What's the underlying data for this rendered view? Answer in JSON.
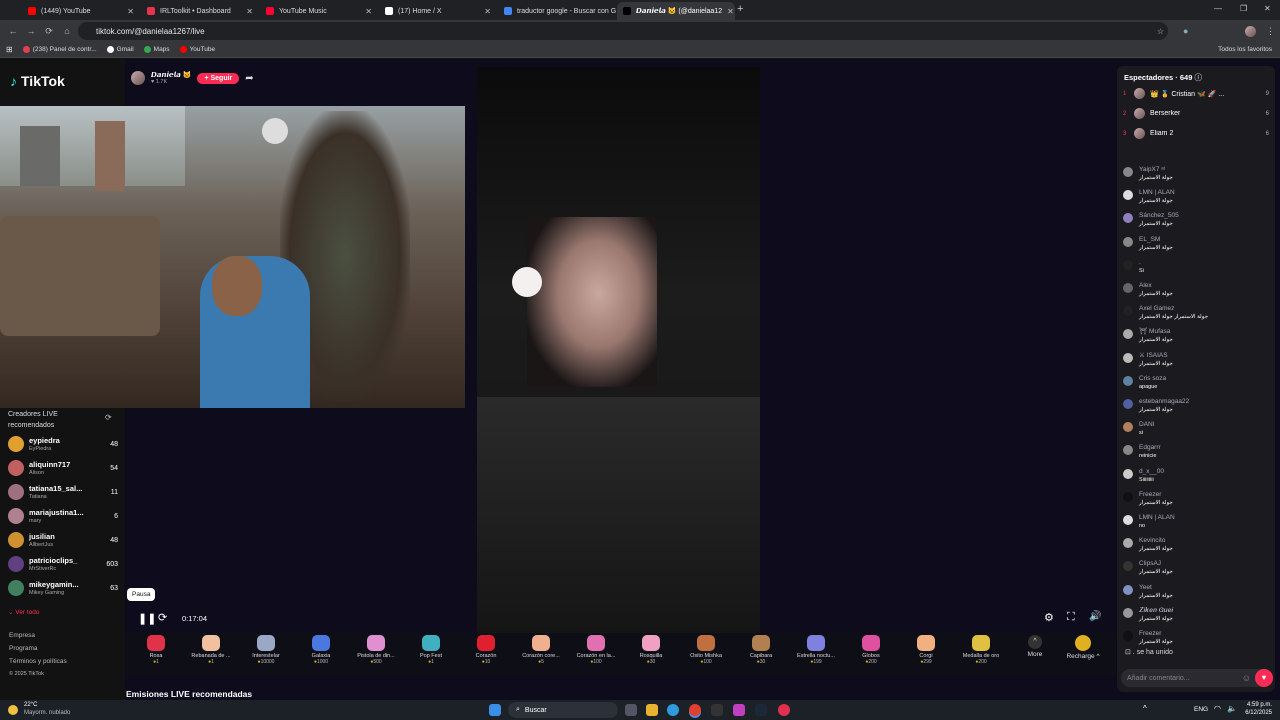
{
  "browser": {
    "tabs": [
      {
        "title": "(1449) YouTube",
        "color": "#ff0000",
        "active": false
      },
      {
        "title": "IRLToolkit • Dashboard",
        "color": "#e8334a",
        "active": false
      },
      {
        "title": "YouTube Music",
        "color": "#ff0033",
        "active": false
      },
      {
        "title": "(17) Home / X",
        "color": "#ffffff",
        "active": false
      },
      {
        "title": "traductor google - Buscar con G",
        "color": "#4285f4",
        "active": false
      },
      {
        "title": "𝘿𝙖𝙣𝙞𝙚𝙡𝙖 🐱 (@danielaa12",
        "color": "#000000",
        "active": true
      }
    ],
    "url": "tiktok.com/@danielaa1267/live",
    "bookmarks": [
      "(238) Panel de contr...",
      "Gmail",
      "Maps",
      "YouTube"
    ],
    "all_favorites": "Todos los favoritos"
  },
  "tiktok": {
    "logo": "TikTok",
    "streamer_name": "𝘿𝙖𝙣𝙞𝙚𝙡𝙖 🐱",
    "streamer_likes": "♥ 1.7K",
    "follow_label": "+ Seguir",
    "recommended_title": "Creadores LIVE recomendados",
    "creators": [
      {
        "name": "eypiedra",
        "sub": "EyPiedra",
        "count": "48",
        "color": "#e0a030"
      },
      {
        "name": "aliquinn717",
        "sub": "Alison",
        "count": "54",
        "color": "#c06060"
      },
      {
        "name": "tatiana15_sal...",
        "sub": "Tatiana",
        "count": "11",
        "color": "#a07080"
      },
      {
        "name": "mariajustina1...",
        "sub": "mary",
        "count": "6",
        "color": "#b08090"
      },
      {
        "name": "jusilian",
        "sub": "AllbertJus",
        "count": "48",
        "color": "#d09030"
      },
      {
        "name": "patricioclips_",
        "sub": "MrStiverRc",
        "count": "603",
        "color": "#604080"
      },
      {
        "name": "mikeygamin...",
        "sub": "Mikey Gaming",
        "count": "63",
        "color": "#408060"
      }
    ],
    "see_all": "Ver todo",
    "footer_links": [
      "Empresa",
      "Programa",
      "Términos y políticas",
      "© 2025 TikTok"
    ],
    "tooltip": "Pausa",
    "timer": "0:17:04",
    "gifts": [
      {
        "name": "Rosa",
        "price": "1",
        "color": "#e0334a"
      },
      {
        "name": "Rebanada de ...",
        "price": "1",
        "color": "#f0c0a0"
      },
      {
        "name": "Interestelar",
        "price": "10000",
        "color": "#9aa8c8"
      },
      {
        "name": "Galaxia",
        "price": "1000",
        "color": "#4a78e0"
      },
      {
        "name": "Pistola de din...",
        "price": "500",
        "color": "#e090d0"
      },
      {
        "name": "Pop Fest",
        "price": "1",
        "color": "#40b0c0"
      },
      {
        "name": "Corazón",
        "price": "10",
        "color": "#e02030"
      },
      {
        "name": "Corazón core...",
        "price": "5",
        "color": "#f0b090"
      },
      {
        "name": "Corazón en la...",
        "price": "100",
        "color": "#e070b0"
      },
      {
        "name": "Rosquilla",
        "price": "30",
        "color": "#f0a0c0"
      },
      {
        "name": "Osito Mishka",
        "price": "100",
        "color": "#c07040"
      },
      {
        "name": "Capibara",
        "price": "30",
        "color": "#b08050"
      },
      {
        "name": "Estrella noctu...",
        "price": "199",
        "color": "#8080e0"
      },
      {
        "name": "Globos",
        "price": "200",
        "color": "#e050a0"
      },
      {
        "name": "Corgi",
        "price": "299",
        "color": "#f0b080"
      },
      {
        "name": "Medalla de oro",
        "price": "200",
        "color": "#e0c040"
      }
    ],
    "more_label": "More",
    "recharge_label": "Recharge ^",
    "emisiones_title": "Emisiones LIVE recomendadas"
  },
  "chat": {
    "viewers_title": "Espectadores · 649",
    "ranking": [
      {
        "rank": "1",
        "name": "👑 🏅 Cristian 🦋 🚀 ...",
        "score": "9"
      },
      {
        "rank": "2",
        "name": "Berserker",
        "score": "6"
      },
      {
        "rank": "3",
        "name": "Eliam 2",
        "score": "6"
      }
    ],
    "messages": [
      {
        "user": "YaipX7 ᵃᵗ",
        "text": "جولة الاستمرار",
        "color": "#888"
      },
      {
        "user": "LMN | ALAN",
        "text": "جولة الاستمرار",
        "color": "#ddd"
      },
      {
        "user": "Sánchez_505",
        "text": "جولة الاستمرار",
        "color": "#9080c0"
      },
      {
        "user": "EL_SM",
        "text": "جولة الاستمرار",
        "color": "#888"
      },
      {
        "user": ".",
        "text": "Si",
        "color": "#222"
      },
      {
        "user": "Alex",
        "text": "جولة الاستمرار",
        "color": "#666"
      },
      {
        "user": "Axel Gamez",
        "text": "جولة الاستمرار جولة الاستمرار",
        "color": "#222"
      },
      {
        "user": "⛩ Mufasa",
        "text": "جولة الاستمرار",
        "color": "#aaa"
      },
      {
        "user": "⚔ ISAIAS",
        "text": "جولة الاستمرار",
        "color": "#bbb"
      },
      {
        "user": "Cris soza",
        "text": "apague",
        "color": "#6080a0"
      },
      {
        "user": "estebanmagaa22",
        "text": "جولة الاستمرار",
        "color": "#5060a0"
      },
      {
        "user": "DANI",
        "text": "si",
        "color": "#b08060"
      },
      {
        "user": "Edgarrr",
        "text": "reinicie",
        "color": "#888"
      },
      {
        "user": "d_x__00",
        "text": "Siiiiiiiii",
        "color": "#ccc"
      },
      {
        "user": "Freezer",
        "text": "جولة الاستمرار",
        "color": "#111"
      },
      {
        "user": "LMN | ALAN",
        "text": "no",
        "color": "#ddd"
      },
      {
        "user": "Kevincito",
        "text": "جولة الاستمرار",
        "color": "#aaa"
      },
      {
        "user": "ClipsAJ",
        "text": "جولة الاستمرار",
        "color": "#333"
      },
      {
        "user": "Yeet",
        "text": "جولة الاستمرار",
        "color": "#8090c0"
      },
      {
        "user": "𝒁𝒊𝒌𝒆𝒏 𝑮𝒖𝒆𝒊",
        "text": "جولة الاستمرار",
        "color": "#999"
      },
      {
        "user": "Freezer",
        "text": "جولة الاستمرار",
        "color": "#111"
      }
    ],
    "joined": "se ha unido",
    "input_placeholder": "Añadir comentario..."
  },
  "taskbar": {
    "weather_temp": "22°C",
    "weather_desc": "Mayorm. nublado",
    "search": "Buscar",
    "lang": "ENG",
    "time": "4:59 p.m.",
    "date": "6/12/2025"
  }
}
